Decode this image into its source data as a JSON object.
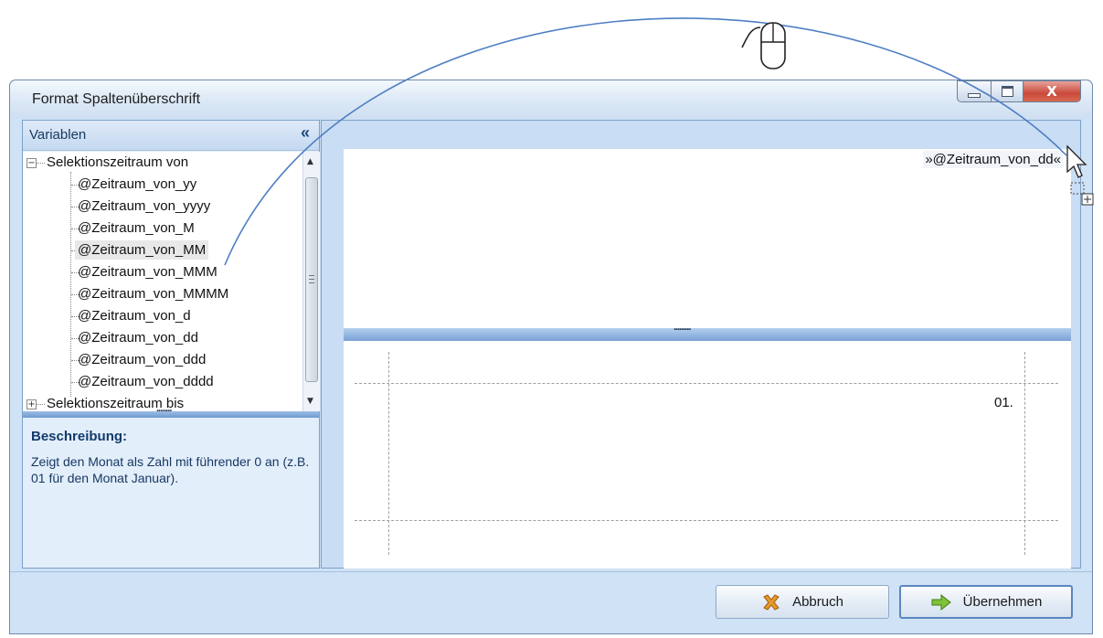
{
  "window": {
    "title": "Format Spaltenüberschrift",
    "buttons": {
      "minimize": "minimize-icon",
      "maximize": "maximize-icon",
      "close_glyph": "X"
    }
  },
  "variables_panel": {
    "title": "Variablen",
    "collapse_glyph": "«",
    "tree": {
      "group1": "Selektionszeitraum von",
      "items": [
        "@Zeitraum_von_yy",
        "@Zeitraum_von_yyyy",
        "@Zeitraum_von_M",
        "@Zeitraum_von_MM",
        "@Zeitraum_von_MMM",
        "@Zeitraum_von_MMMM",
        "@Zeitraum_von_d",
        "@Zeitraum_von_dd",
        "@Zeitraum_von_ddd",
        "@Zeitraum_von_dddd"
      ],
      "selected_index": 3,
      "group2": "Selektionszeitraum bis"
    },
    "splitter_grip": "........",
    "description_title": "Beschreibung:",
    "description_text": "Zeigt den Monat als Zahl mit führender 0 an (z.B. 01 für den Monat Januar)."
  },
  "editor": {
    "content": "»@Zeitraum_von_dd«",
    "splitter_grip": ".........",
    "preview_value": "01."
  },
  "buttons": {
    "cancel": "Abbruch",
    "apply": "Übernehmen"
  },
  "colors": {
    "arc": "#4f7fc4",
    "accent": "#6e9bd1"
  }
}
